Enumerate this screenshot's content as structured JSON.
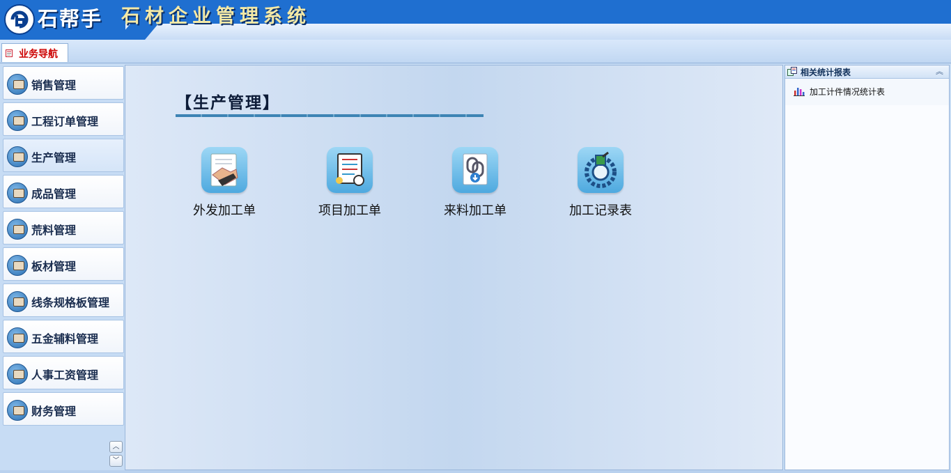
{
  "header": {
    "brand": "石帮手",
    "app_title": "石材企业管理系统"
  },
  "tabs": [
    {
      "label": "业务导航"
    }
  ],
  "sidebar": {
    "items": [
      {
        "label": "销售管理",
        "active": false
      },
      {
        "label": "工程订单管理",
        "active": false
      },
      {
        "label": "生产管理",
        "active": true
      },
      {
        "label": "成品管理",
        "active": false
      },
      {
        "label": "荒料管理",
        "active": false
      },
      {
        "label": "板材管理",
        "active": false
      },
      {
        "label": "线条规格板管理",
        "active": false
      },
      {
        "label": "五金辅料管理",
        "active": false
      },
      {
        "label": "人事工资管理",
        "active": false
      },
      {
        "label": "财务管理",
        "active": false
      }
    ],
    "scroll_up": "︿",
    "scroll_down": "﹀"
  },
  "main": {
    "section_title": "【生产管理】",
    "functions": [
      {
        "label": "外发加工单",
        "icon": "handshake-contract-icon"
      },
      {
        "label": "项目加工单",
        "icon": "document-clock-icon"
      },
      {
        "label": "来料加工单",
        "icon": "chain-link-download-icon"
      },
      {
        "label": "加工记录表",
        "icon": "gear-record-icon"
      }
    ]
  },
  "right_panel": {
    "title": "相关统计报表",
    "collapse_glyph": "︽",
    "links": [
      {
        "label": "加工计件情况统计表",
        "icon": "bar-chart-icon"
      }
    ]
  },
  "colors": {
    "header_blue": "#1f6fd0",
    "tab_label_red": "#cc0000",
    "accent_rule": "#3d84b4"
  }
}
